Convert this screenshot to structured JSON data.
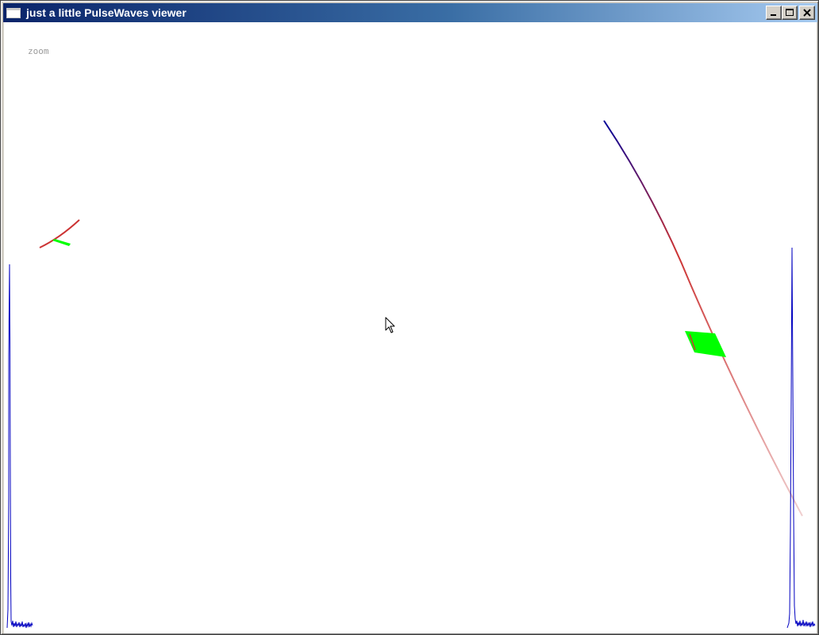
{
  "window": {
    "title": "just a little PulseWaves viewer",
    "buttons": {
      "minimize_icon": "minimize-icon",
      "maximize_icon": "maximize-icon",
      "close_icon": "close-icon"
    }
  },
  "viewport": {
    "mode_label": "zoom",
    "colors": {
      "background": "#ffffff",
      "waveform": "#0000c0",
      "pulse_start": "#000099",
      "pulse_end": "#cc3333",
      "samples": "#00ff00"
    },
    "elements": [
      "left-pulse-trajectory",
      "left-sample-cluster",
      "right-pulse-trajectory",
      "right-sample-cluster",
      "left-waveform",
      "right-waveform",
      "mouse-cursor-icon"
    ]
  }
}
